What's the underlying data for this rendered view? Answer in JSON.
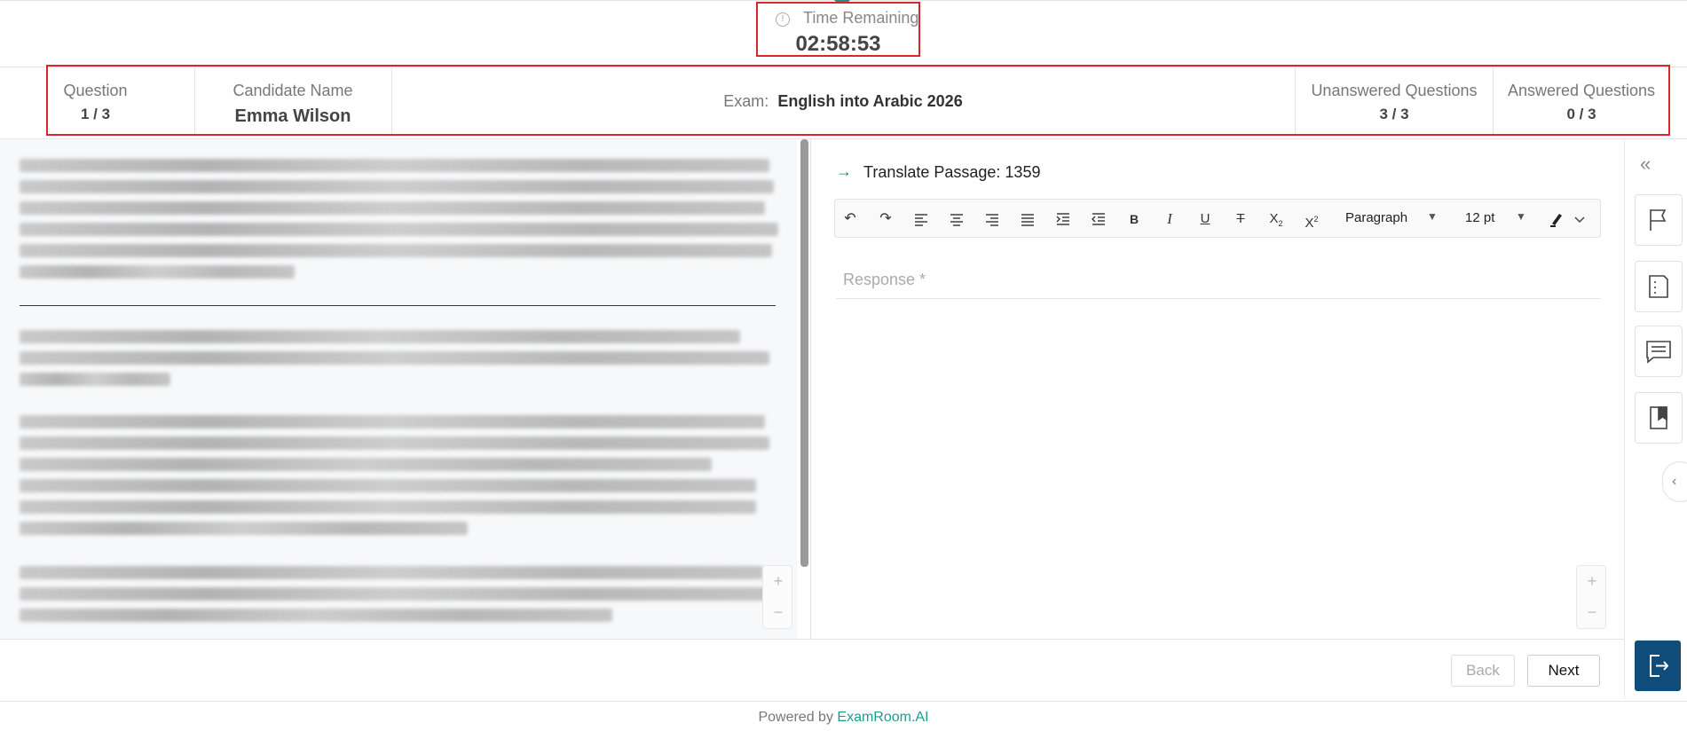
{
  "timer": {
    "label": "Time Remaining",
    "value": "02:58:53"
  },
  "header": {
    "question_label": "Question",
    "question_value": "1 / 3",
    "candidate_label": "Candidate Name",
    "candidate_value": "Emma Wilson",
    "exam_label": "Exam:",
    "exam_value": "English into Arabic 2026",
    "unanswered_label": "Unanswered Questions",
    "unanswered_value": "3 / 3",
    "answered_label": "Answered Questions",
    "answered_value": "0 / 3"
  },
  "editor": {
    "passage_title": "Translate Passage: 1359",
    "block_format": "Paragraph",
    "font_size": "12 pt",
    "response_placeholder": "Response *"
  },
  "toolbar_icons": [
    "undo-icon",
    "redo-icon",
    "align-left-icon",
    "align-center-icon",
    "align-right-icon",
    "align-justify-icon",
    "indent-icon",
    "outdent-icon",
    "bold-icon",
    "italic-icon",
    "underline-icon",
    "strikethrough-icon",
    "subscript-icon",
    "superscript-icon"
  ],
  "navigation": {
    "back_label": "Back",
    "next_label": "Next"
  },
  "footer": {
    "powered_by": "Powered by",
    "brand": "ExamRoom.AI"
  },
  "colors": {
    "accent": "#1a9e8f",
    "highlight_border": "#d9262c",
    "exit_button": "#0f4c7a"
  }
}
